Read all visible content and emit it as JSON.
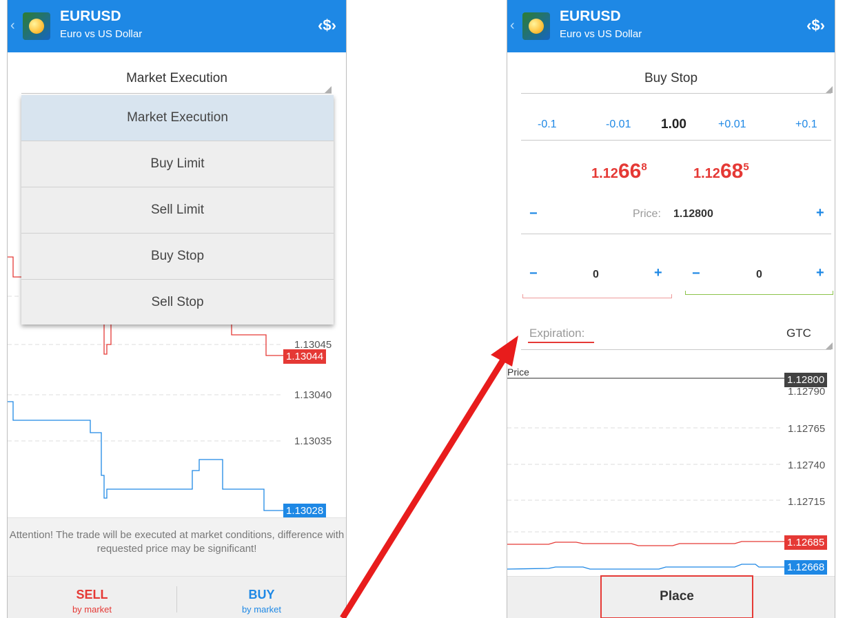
{
  "colors": {
    "accent": "#1e88e5",
    "sell": "#e53935",
    "buy": "#1e88e5",
    "sl_line": "#ef9a9a",
    "tp_line": "#8bc34a"
  },
  "left": {
    "header": {
      "symbol": "EURUSD",
      "description": "Euro vs US Dollar",
      "back_icon": "chevron-left-icon",
      "trade_icon": "trade-currency-icon"
    },
    "order_type": "Market Execution",
    "menu": [
      "Market Execution",
      "Buy Limit",
      "Sell Limit",
      "Buy Stop",
      "Sell Stop"
    ],
    "chart": {
      "labels": [
        "1.13045",
        "1.13040",
        "1.13035"
      ],
      "bid_tag": "1.13044",
      "ask_tag": "1.13028"
    },
    "attention": "Attention! The trade will be executed at market conditions, difference with requested price may be significant!",
    "sell": {
      "label": "SELL",
      "sub": "by market"
    },
    "buy": {
      "label": "BUY",
      "sub": "by market"
    }
  },
  "right": {
    "header": {
      "symbol": "EURUSD",
      "description": "Euro vs US Dollar",
      "back_icon": "chevron-left-icon",
      "trade_icon": "trade-currency-icon"
    },
    "order_type": "Buy Stop",
    "volume": {
      "m01": "-0.1",
      "m001": "-0.01",
      "value": "1.00",
      "p001": "+0.01",
      "p01": "+0.1"
    },
    "bid": {
      "prefix": "1.12",
      "big": "66",
      "sup": "8"
    },
    "ask": {
      "prefix": "1.12",
      "big": "68",
      "sup": "5"
    },
    "price": {
      "minus": "−",
      "label": "Price:",
      "value": "1.12800",
      "plus": "+"
    },
    "sl": {
      "minus": "−",
      "value": "0",
      "plus": "+"
    },
    "tp": {
      "minus": "−",
      "value": "0",
      "plus": "+"
    },
    "expiration": {
      "label": "Expiration:",
      "value": "GTC"
    },
    "chart": {
      "price_label": "Price",
      "price_tag": "1.12800",
      "labels": [
        "1.12790",
        "1.12765",
        "1.12740",
        "1.12715"
      ],
      "bid_tag": "1.12685",
      "ask_tag": "1.12668"
    },
    "place_label": "Place"
  }
}
